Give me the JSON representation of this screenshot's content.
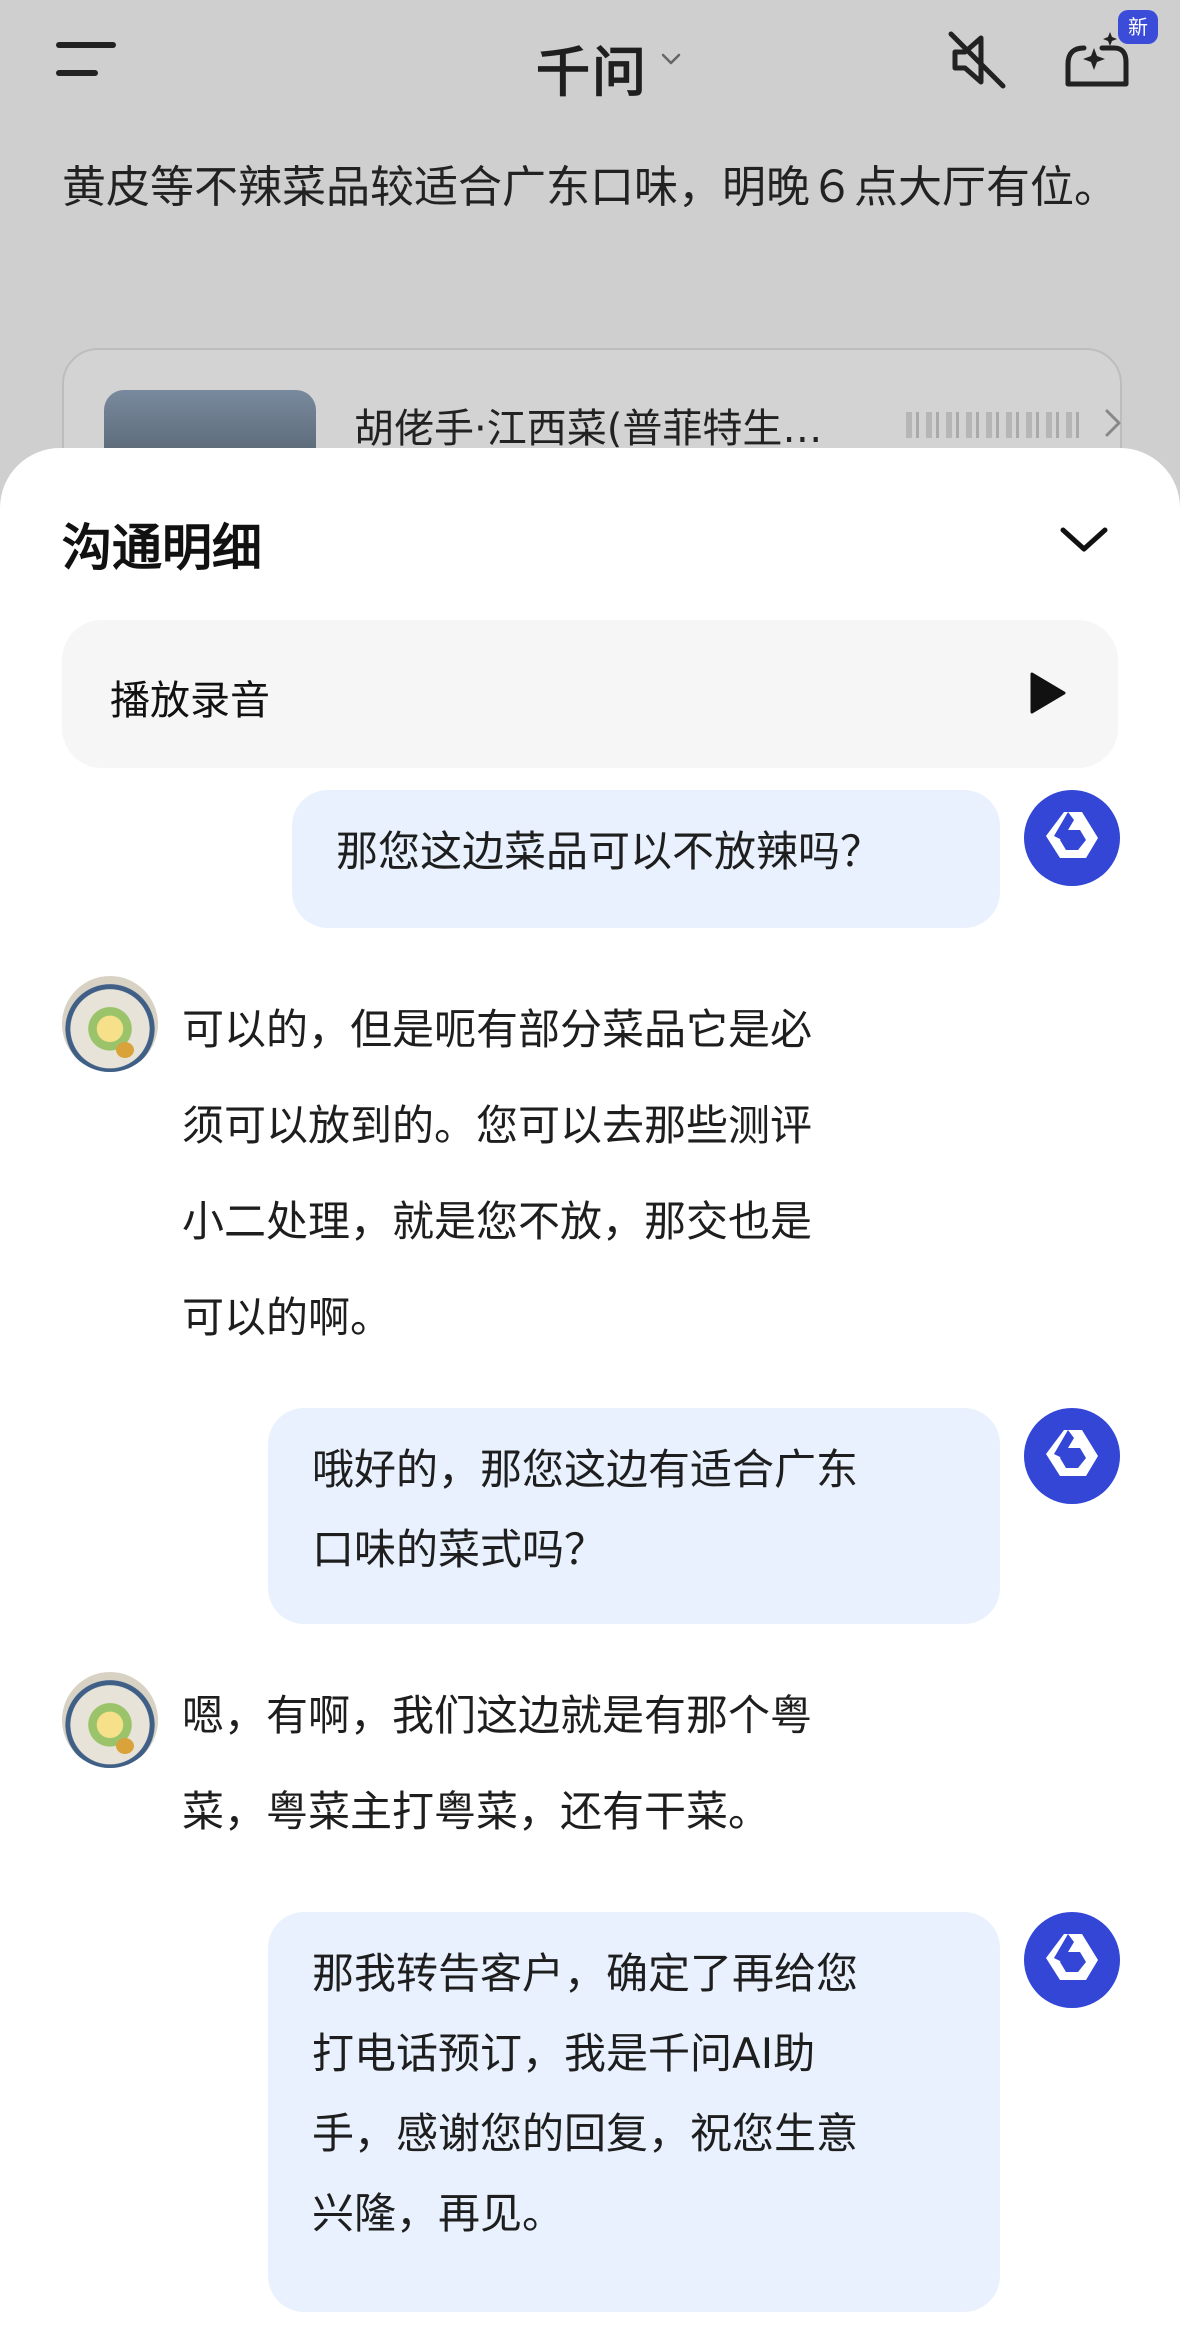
{
  "header": {
    "app_title": "千问",
    "new_badge": "新"
  },
  "background": {
    "message_text": "黄皮等不辣菜品较适合广东口味，明晚６点大厅有位。",
    "shop_card": {
      "name": "胡佬手·江西菜(普菲特生…"
    }
  },
  "sheet": {
    "title": "沟通明细",
    "play_label": "播放录音",
    "messages": [
      {
        "role": "ai",
        "text": "那您这边菜品可以不放辣吗？"
      },
      {
        "role": "merchant",
        "lines": [
          "可以的，但是呃有部分菜品它是必",
          "须可以放到的。您可以去那些测评",
          "小二处理，就是您不放，那交也是",
          "可以的啊。"
        ]
      },
      {
        "role": "ai",
        "lines": [
          "哦好的，那您这边有适合广东",
          "口味的菜式吗？"
        ]
      },
      {
        "role": "merchant",
        "lines": [
          "嗯，有啊，我们这边就是有那个粤",
          "菜，粤菜主打粤菜，还有干菜。"
        ]
      },
      {
        "role": "ai",
        "lines": [
          "那我转告客户，确定了再给您",
          "打电话预订，我是千问AI助",
          "手，感谢您的回复，祝您生意",
          "兴隆，再见。"
        ]
      }
    ]
  },
  "colors": {
    "ai_bubble": "#e8f1fd",
    "ai_avatar": "#3346d6",
    "badge": "#3a4cd8"
  },
  "icons": [
    "menu-icon",
    "chevron-down-icon",
    "speaker-mute-icon",
    "sparkle-new-chat-icon",
    "collapse-chevron-icon",
    "play-icon",
    "ai-assistant-avatar-icon"
  ]
}
